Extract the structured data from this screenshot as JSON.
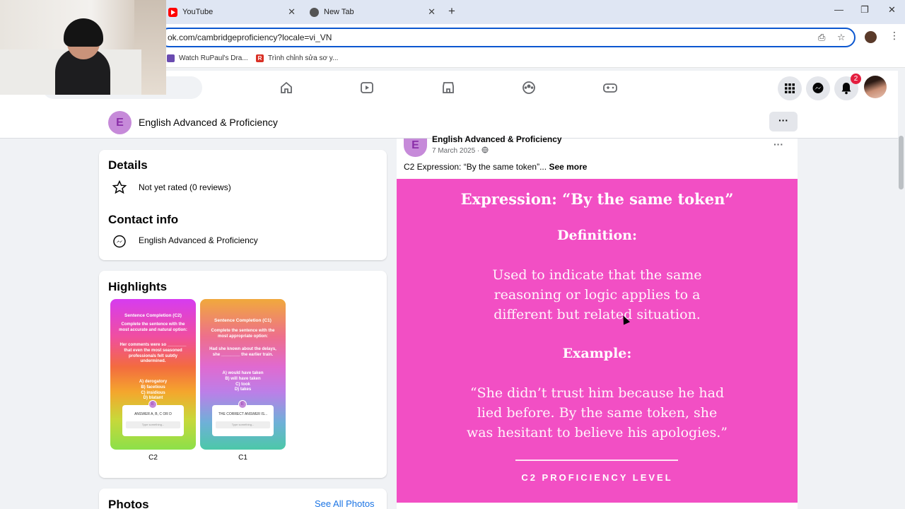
{
  "browser": {
    "tabs": [
      {
        "label": "YouTube",
        "icon": "youtube-icon"
      },
      {
        "label": "New Tab",
        "icon": "chrome-icon"
      }
    ],
    "url": "ok.com/cambridgeproficiency?locale=vi_VN",
    "bookmarks": [
      {
        "label": "Watch RuPaul's Dra...",
        "icon": "bookmark-favicon"
      },
      {
        "label": "Trình chỉnh sửa sơ y...",
        "icon": "bookmark-favicon-r"
      }
    ]
  },
  "fb_nav": {
    "notification_count": "2"
  },
  "page_header": {
    "avatar_letter": "E",
    "title": "English Advanced & Proficiency",
    "more_label": "···"
  },
  "details": {
    "heading": "Details",
    "rating": "Not yet rated (0 reviews)"
  },
  "contact": {
    "heading": "Contact info",
    "messenger": "English Advanced & Proficiency"
  },
  "highlights": {
    "heading": "Highlights",
    "items": [
      {
        "caption": "C2",
        "title": "Sentence Completion (C2)",
        "prompt": "Complete the sentence with the most accurate and natural option:",
        "sentence": "Her comments were so ________ that even the most seasoned professionals felt subtly undermined.",
        "options": "A) derogatory\nB) facetious\nC) insidious\nD) blatant",
        "box_text": "ANSWER A, B, C OR D",
        "input_placeholder": "Type something..."
      },
      {
        "caption": "C1",
        "title": "Sentence Completion (C1)",
        "prompt": "Complete the sentence with the most appropriate option:",
        "sentence": "Had she known about the delays, she ________ the earlier train.",
        "options": "A) would have taken\nB) will have taken\nC) took\nD) takes",
        "box_text": "THE CORRECT ANSWER IS...",
        "input_placeholder": "Type something..."
      }
    ]
  },
  "photos": {
    "heading": "Photos",
    "see_all": "See All Photos"
  },
  "post": {
    "author": "English Advanced & Proficiency",
    "date": "7 March 2025 ·",
    "text": "C2 Expression: “By the same token”...",
    "see_more": "See more",
    "image": {
      "heading": "Expression: “By the same token”",
      "def_heading": "Definition:",
      "def_line1": "Used to indicate that the same",
      "def_line2": "reasoning or logic applies to a",
      "def_line3": "different but related situation.",
      "ex_heading": "Example:",
      "ex_line1": "“She didn’t trust him because he had",
      "ex_line2": "lied before. By the same token, she",
      "ex_line3": "was hesitant to believe his apologies.”",
      "footer": "C2 PROFICIENCY LEVEL"
    }
  },
  "colors": {
    "accent": "#1b74e4",
    "image_bg": "#f24fc4",
    "badge": "#e41e3f"
  }
}
